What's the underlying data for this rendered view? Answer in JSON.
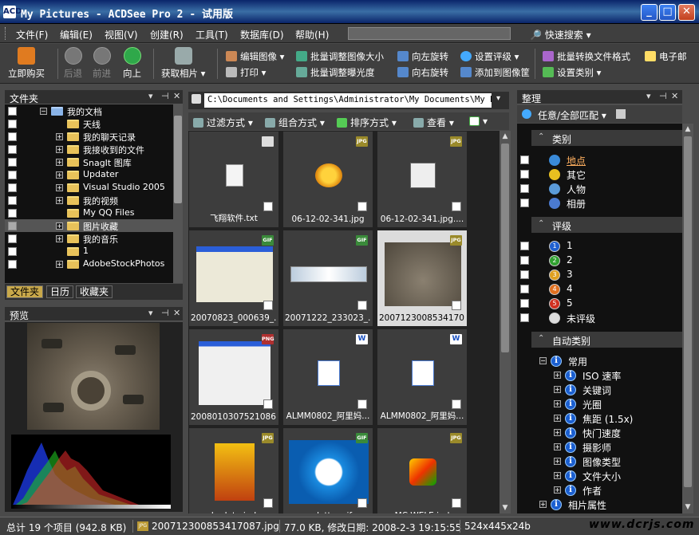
{
  "window": {
    "title": "My Pictures - ACDSee Pro 2 - 试用版",
    "app_icon": "ACD"
  },
  "menu": {
    "items": [
      "文件(F)",
      "编辑(E)",
      "视图(V)",
      "创建(R)",
      "工具(T)",
      "数据库(D)",
      "帮助(H)"
    ],
    "quick_search": "快速搜索"
  },
  "toolbar": {
    "buy": "立即购买",
    "back": "后退",
    "forward": "前进",
    "up": "向上",
    "acquire": "获取相片",
    "edit_image": "编辑图像",
    "print": "打印",
    "batch_resize": "批量调整图像大小",
    "batch_exposure": "批量调整曝光度",
    "rotate_left": "向左旋转",
    "rotate_right": "向右旋转",
    "set_rating": "设置评级",
    "add_basket": "添加到图像筐",
    "batch_convert": "批量转换文件格式",
    "email": "电子邮",
    "set_category": "设置类别"
  },
  "folders_panel": {
    "title": "文件夹",
    "items": [
      {
        "label": "我的文档",
        "expander": "−",
        "level": 0
      },
      {
        "label": "天线",
        "expander": "",
        "level": 1
      },
      {
        "label": "我的聊天记录",
        "expander": "+",
        "level": 1
      },
      {
        "label": "我接收到的文件",
        "expander": "+",
        "level": 1
      },
      {
        "label": "SnagIt 图库",
        "expander": "+",
        "level": 1
      },
      {
        "label": "Updater",
        "expander": "+",
        "level": 1
      },
      {
        "label": "Visual Studio 2005",
        "expander": "+",
        "level": 1
      },
      {
        "label": "我的视频",
        "expander": "+",
        "level": 1
      },
      {
        "label": "My QQ Files",
        "expander": "",
        "level": 1
      },
      {
        "label": "图片收藏",
        "expander": "+",
        "level": 1,
        "selected": true
      },
      {
        "label": "我的音乐",
        "expander": "+",
        "level": 1
      },
      {
        "label": "1",
        "expander": "",
        "level": 1
      },
      {
        "label": "AdobeStockPhotos",
        "expander": "+",
        "level": 1
      }
    ],
    "tabs": [
      "文件夹",
      "日历",
      "收藏夹"
    ]
  },
  "preview_panel": {
    "title": "预览"
  },
  "address": {
    "path": "C:\\Documents and Settings\\Administrator\\My Documents\\My Pict"
  },
  "filterbar": {
    "filter": "过滤方式",
    "group": "组合方式",
    "sort": "排序方式",
    "view": "查看"
  },
  "files": [
    {
      "name": "飞翔软件.txt",
      "type": "",
      "kind": "txt"
    },
    {
      "name": "06-12-02-341.jpg",
      "type": "JPG",
      "kind": "fish"
    },
    {
      "name": "06-12-02-341.jpg....",
      "type": "JPG",
      "kind": "vlogo"
    },
    {
      "name": "20070823_000639_...",
      "type": "GIF",
      "kind": "dialog"
    },
    {
      "name": "20071222_233023_...",
      "type": "GIF",
      "kind": "bar"
    },
    {
      "name": "2007123008534170...",
      "type": "JPG",
      "kind": "photo",
      "selected": true
    },
    {
      "name": "2008010307521086...",
      "type": "PNG",
      "kind": "dialog2"
    },
    {
      "name": "ALMM0802_阿里妈...",
      "type": "W",
      "kind": "word"
    },
    {
      "name": "ALMM0802_阿里妈...",
      "type": "W",
      "kind": "word"
    },
    {
      "name": "hadata.ipd",
      "type": "JPG",
      "kind": "game"
    },
    {
      "name": "ss_letter.gif",
      "type": "GIF",
      "kind": "klogo"
    },
    {
      "name": "MC.WELE.ipd",
      "type": "JPG",
      "kind": "media"
    }
  ],
  "organize_panel": {
    "title": "整理",
    "match": "任意/全部匹配",
    "categories": {
      "title": "类别",
      "items": [
        "地点",
        "其它",
        "人物",
        "相册"
      ]
    },
    "ratings": {
      "title": "评级",
      "items": [
        "1",
        "2",
        "3",
        "4",
        "5",
        "未评级"
      ]
    },
    "auto_categories": {
      "title": "自动类别",
      "items": [
        {
          "label": "常用",
          "level": 0,
          "expander": "−"
        },
        {
          "label": "ISO 速率",
          "level": 1,
          "expander": "+"
        },
        {
          "label": "关键词",
          "level": 1,
          "expander": "+"
        },
        {
          "label": "光圈",
          "level": 1,
          "expander": "+"
        },
        {
          "label": "焦距 (1.5x)",
          "level": 1,
          "expander": "+"
        },
        {
          "label": "快门速度",
          "level": 1,
          "expander": "+"
        },
        {
          "label": "摄影师",
          "level": 1,
          "expander": "+"
        },
        {
          "label": "图像类型",
          "level": 1,
          "expander": "+"
        },
        {
          "label": "文件大小",
          "level": 1,
          "expander": "+"
        },
        {
          "label": "作者",
          "level": 1,
          "expander": "+"
        },
        {
          "label": "相片属性",
          "level": 0,
          "expander": "+"
        }
      ]
    }
  },
  "status": {
    "total": "总计 19 个项目 (942.8 KB)",
    "file": "20071230085341708​7.jpg",
    "info": "77.0 KB, 修改日期: 2008-2-3 19:15:55",
    "dims": "524x445x24b"
  },
  "watermark": "www.dcrjs.com",
  "colors": {
    "accent": "#0a246a",
    "selected_folder": "#555555",
    "rating": [
      "#2060d0",
      "#30a030",
      "#e0a020",
      "#e07020",
      "#d03020"
    ]
  }
}
